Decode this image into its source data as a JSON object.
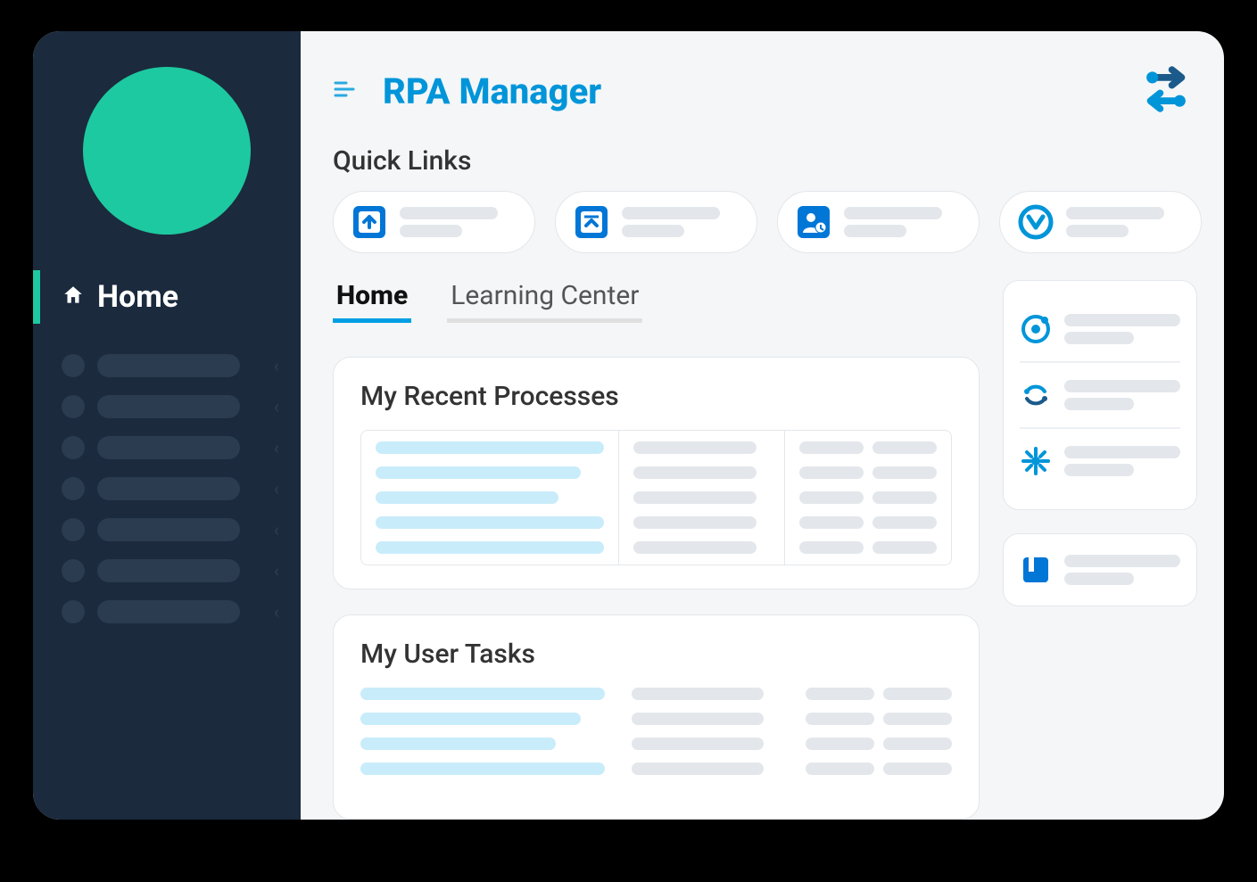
{
  "app": {
    "title": "RPA Manager"
  },
  "sidebar": {
    "home_label": "Home",
    "items": [
      {
        "label": ""
      },
      {
        "label": ""
      },
      {
        "label": ""
      },
      {
        "label": ""
      },
      {
        "label": ""
      },
      {
        "label": ""
      },
      {
        "label": ""
      }
    ]
  },
  "sections": {
    "quick_links_label": "Quick Links"
  },
  "quick_links": [
    {
      "icon": "upload",
      "label": ""
    },
    {
      "icon": "publish",
      "label": ""
    },
    {
      "icon": "user",
      "label": ""
    },
    {
      "icon": "mulesoft",
      "label": ""
    }
  ],
  "tabs": {
    "home": "Home",
    "learning_center": "Learning Center"
  },
  "panels": {
    "recent_processes": "My Recent Processes",
    "user_tasks": "My User Tasks"
  },
  "right_rail": {
    "group1": [
      {
        "icon": "target"
      },
      {
        "icon": "cycle"
      },
      {
        "icon": "spark"
      }
    ],
    "group2": [
      {
        "icon": "book"
      }
    ]
  },
  "colors": {
    "accent": "#009fe3",
    "avatar": "#1dc9a0",
    "sidebar": "#1b2a3d",
    "placeholder_blue": "#c9ecfb",
    "placeholder_grey": "#e3e7eb"
  }
}
